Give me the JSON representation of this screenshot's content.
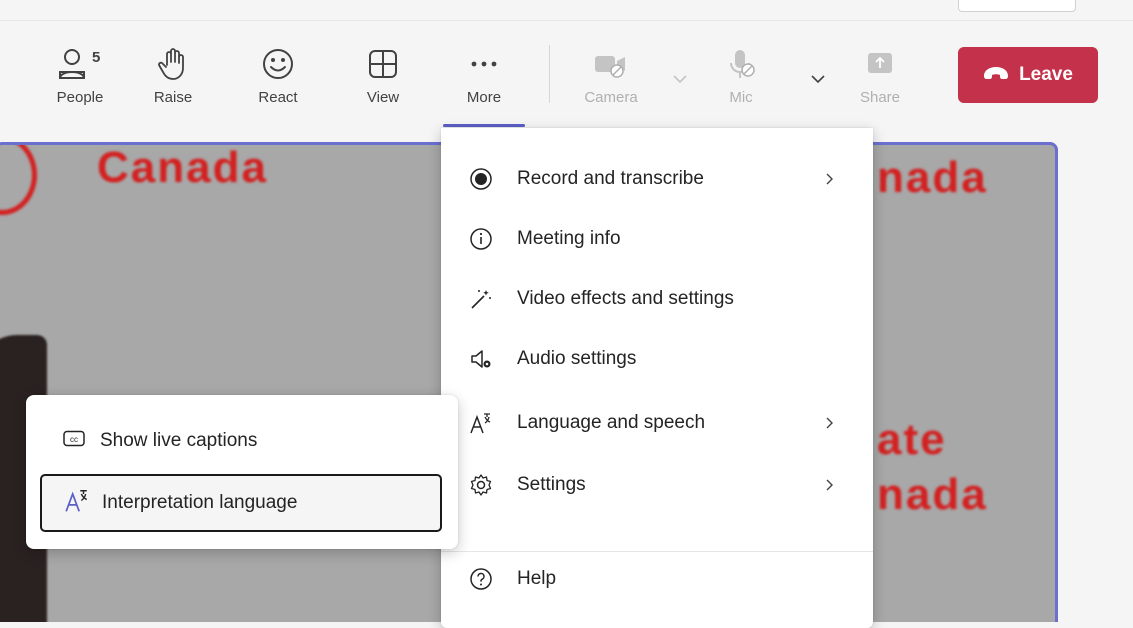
{
  "toolbar": {
    "people_label": "People",
    "people_count": "5",
    "raise_label": "Raise",
    "react_label": "React",
    "view_label": "View",
    "more_label": "More",
    "camera_label": "Camera",
    "mic_label": "Mic",
    "share_label": "Share",
    "leave_label": "Leave"
  },
  "video": {
    "text_top_left": "Canada",
    "text_top_right": "nada",
    "text_mid_right": "ate",
    "text_low_right": "nada"
  },
  "more_menu": {
    "items": [
      {
        "label": "Record and transcribe",
        "icon": "record-icon",
        "submenu": true
      },
      {
        "label": "Meeting info",
        "icon": "info-icon",
        "submenu": false
      },
      {
        "label": "Video effects and settings",
        "icon": "magic-wand-icon",
        "submenu": false
      },
      {
        "label": "Audio settings",
        "icon": "speaker-settings-icon",
        "submenu": false
      },
      {
        "label": "Language and speech",
        "icon": "language-icon",
        "submenu": true
      },
      {
        "label": "Settings",
        "icon": "gear-icon",
        "submenu": true
      },
      {
        "label": "Help",
        "icon": "help-icon",
        "submenu": false
      }
    ]
  },
  "language_submenu": {
    "items": [
      {
        "label": "Show live captions",
        "icon": "closed-captions-icon"
      },
      {
        "label": "Interpretation language",
        "icon": "interpretation-icon",
        "focused": true
      }
    ]
  },
  "colors": {
    "accent": "#5b5fc7",
    "leave": "#c4314b",
    "video_text": "#d32020"
  }
}
